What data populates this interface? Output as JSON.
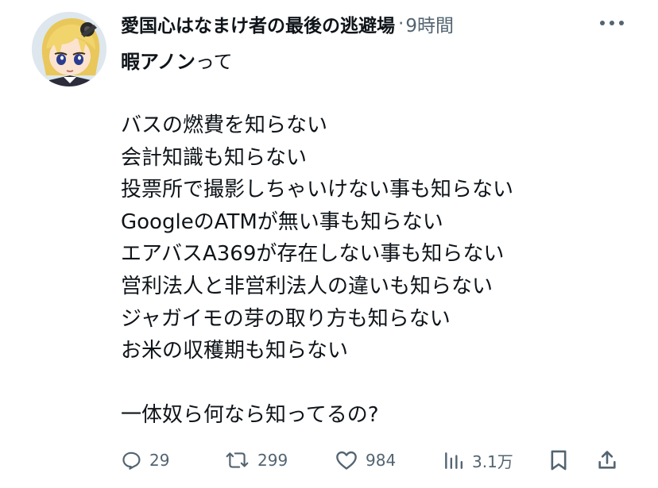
{
  "author": {
    "display_name": "愛国心はなまけ者の最後の逃避場",
    "separator": "·",
    "time": "9時間",
    "avatar_icon": "anime-character-avatar"
  },
  "subline": {
    "bold_text": "暇アノン",
    "plain_text": "って"
  },
  "body_lines": [
    "バスの燃費を知らない",
    "会計知識も知らない",
    "投票所で撮影しちゃいけない事も知らない",
    "GoogleのATMが無い事も知らない",
    "エアバスA369が存在しない事も知らない",
    "営利法人と非営利法人の違いも知らない",
    "ジャガイモの芽の取り方も知らない",
    "お米の収穫期も知らない",
    "",
    "一体奴ら何なら知ってるの?"
  ],
  "actions": {
    "reply": {
      "icon": "reply-icon",
      "count": "29"
    },
    "retweet": {
      "icon": "retweet-icon",
      "count": "299"
    },
    "like": {
      "icon": "heart-icon",
      "count": "984"
    },
    "views": {
      "icon": "views-icon",
      "count": "3.1万"
    },
    "bookmark": {
      "icon": "bookmark-icon"
    },
    "share": {
      "icon": "share-icon"
    }
  },
  "colors": {
    "text": "#0f1419",
    "secondary": "#536471",
    "background": "#ffffff"
  }
}
